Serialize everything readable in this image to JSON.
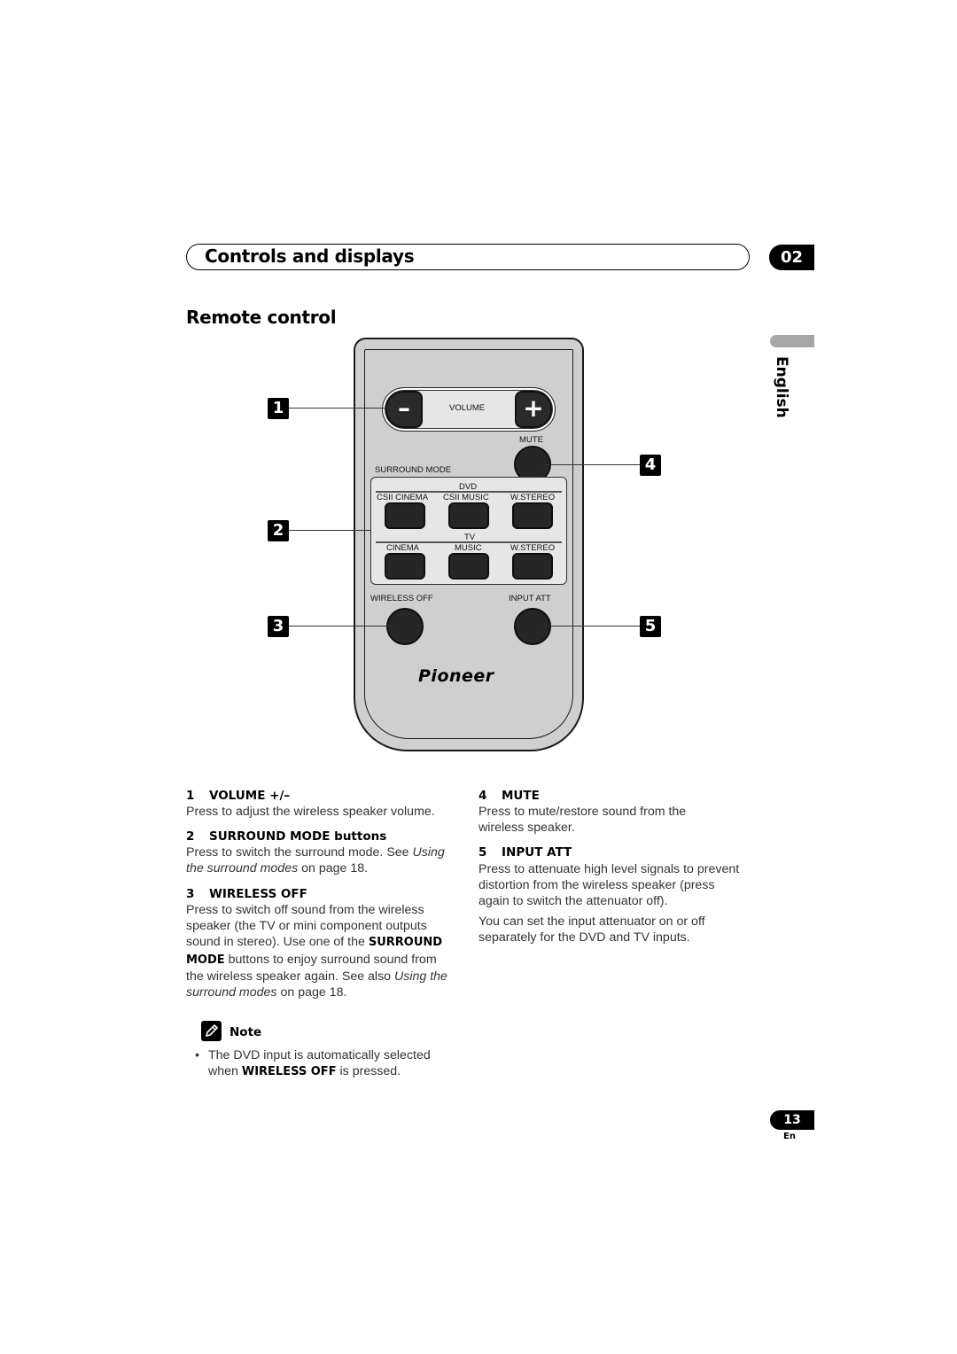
{
  "header": {
    "chapter_title": "Controls and displays",
    "chapter_number": "02",
    "section_title": "Remote control",
    "language_tab": "English"
  },
  "remote": {
    "volume_label": "VOLUME",
    "volume_minus": "–",
    "volume_plus": "+",
    "mute_label": "MUTE",
    "surround_mode_label": "SURROUND MODE",
    "dvd_group": {
      "label": "DVD",
      "buttons": [
        "CSII CINEMA",
        "CSII  MUSIC",
        "W.STEREO"
      ]
    },
    "tv_group": {
      "label": "TV",
      "buttons": [
        "CINEMA",
        "MUSIC",
        "W.STEREO"
      ]
    },
    "wireless_off_label": "WIRELESS OFF",
    "input_att_label": "INPUT ATT",
    "brand": "Pioneer"
  },
  "callouts": [
    "1",
    "2",
    "3",
    "4",
    "5"
  ],
  "items": [
    {
      "number": "1",
      "title": "VOLUME +/–",
      "text": "Press to adjust the wireless speaker volume."
    },
    {
      "number": "2",
      "title": "SURROUND MODE buttons",
      "text_1": "Press to switch the surround mode. See ",
      "ref": "Using the surround modes",
      "text_2": " on page 18."
    },
    {
      "number": "3",
      "title": "WIRELESS OFF",
      "text_1": "Press to switch off sound from the wireless speaker (the TV or mini component outputs sound in stereo). Use one of the ",
      "bold": "SURROUND MODE",
      "text_2": " buttons to enjoy surround sound from the wireless speaker again. See also ",
      "ref": "Using the surround modes",
      "text_3": " on page 18."
    },
    {
      "number": "4",
      "title": "MUTE",
      "text": "Press to mute/restore sound from the wireless speaker."
    },
    {
      "number": "5",
      "title": "INPUT ATT",
      "text": "Press to attenuate high level signals to prevent distortion from the wireless speaker (press again to switch the attenuator off).",
      "text_extra": "You can set the input attenuator on or off separately for the DVD and TV inputs."
    }
  ],
  "note": {
    "label": "Note",
    "bullet": "•",
    "text_1": "The DVD input is automatically selected when ",
    "bold": "WIRELESS OFF",
    "text_2": " is pressed."
  },
  "footer": {
    "page_number": "13",
    "language_code": "En"
  }
}
